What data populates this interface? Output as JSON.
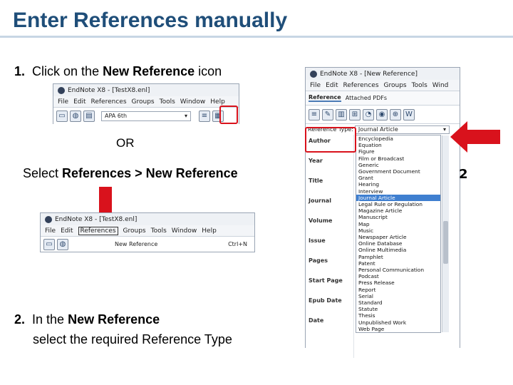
{
  "slide": {
    "title": "Enter References manually",
    "step1": {
      "number": "1.",
      "pre": "Click on the ",
      "bold": "New Reference",
      "post": " icon"
    },
    "or": "OR",
    "select": {
      "pre": "Select ",
      "bold": "References > New Reference"
    },
    "step2": {
      "number": "2.",
      "pre": "In the ",
      "bold": "New Reference",
      "line2": "select the required Reference Type"
    },
    "badge": "2"
  },
  "win1": {
    "title": "EndNote X8 - [TestX8.enl]",
    "menu": [
      "File",
      "Edit",
      "References",
      "Groups",
      "Tools",
      "Window",
      "Help"
    ],
    "style": "APA 6th"
  },
  "win2": {
    "title": "EndNote X8 - [TestX8.enl]",
    "menu": [
      "File",
      "Edit",
      "References",
      "Groups",
      "Tools",
      "Window",
      "Help"
    ],
    "menu_item": "New Reference",
    "shortcut": "Ctrl+N"
  },
  "win3": {
    "title": "EndNote X8 - [New Reference]",
    "menu": [
      "File",
      "Edit",
      "References",
      "Groups",
      "Tools",
      "Wind"
    ],
    "tabs": [
      "Reference",
      "Attached PDFs"
    ],
    "type_label": "Reference Type:",
    "type_value": "Journal Article",
    "fields": [
      "Author",
      "Year",
      "Title",
      "Journal",
      "Volume",
      "Issue",
      "Pages",
      "Start Page",
      "Epub Date",
      "Date"
    ],
    "types": [
      "Encyclopedia",
      "Equation",
      "Figure",
      "Film or Broadcast",
      "Generic",
      "Government Document",
      "Grant",
      "Hearing",
      "Interview",
      "Journal Article",
      "Legal Rule or Regulation",
      "Magazine Article",
      "Manuscript",
      "Map",
      "Music",
      "Newspaper Article",
      "Online Database",
      "Online Multimedia",
      "Pamphlet",
      "Patent",
      "Personal Communication",
      "Podcast",
      "Press Release",
      "Report",
      "Serial",
      "Standard",
      "Statute",
      "Thesis",
      "Unpublished Work",
      "Web Page"
    ],
    "selected_type": "Journal Article"
  },
  "colors": {
    "title": "#1f4e79",
    "highlight": "#d9121c",
    "selection": "#3f7fd0"
  }
}
